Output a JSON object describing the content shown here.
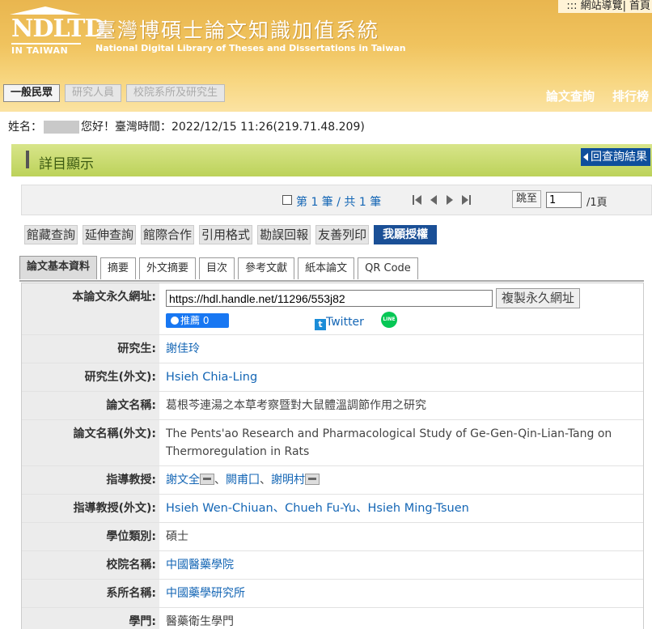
{
  "top_links": [
    "::: 網站導覽",
    "首頁"
  ],
  "brand": {
    "logo_main": "NDLTD",
    "logo_sub": "IN TAIWAN",
    "title_zh": "臺灣博碩士論文知識加值系統",
    "title_en": "National Digital Library of Theses and Dissertations in Taiwan"
  },
  "role_tabs": [
    "一般民眾",
    "研究人員",
    "校院系所及研究生"
  ],
  "nav_links": [
    "論文查詢",
    "排行榜"
  ],
  "greeting": {
    "name_label": "姓名：",
    "text": "您好！臺灣時間：2022/12/15 11:26(219.71.48.209)"
  },
  "panel": {
    "title": "詳目顯示",
    "back_label": "回查詢結果"
  },
  "pager": {
    "count": "第 1 筆 / 共 1 筆",
    "jump_label": "跳至",
    "jump_value": "1",
    "total": "/1頁"
  },
  "tools": [
    "館藏查詢",
    "延伸查詢",
    "館際合作",
    "引用格式",
    "勘誤回報",
    "友善列印",
    "我願授權"
  ],
  "tabs": [
    "論文基本資料",
    "摘要",
    "外文摘要",
    "目次",
    "參考文獻",
    "紙本論文",
    "QR Code"
  ],
  "record": {
    "url_label": "本論文永久網址:",
    "url_value": "https://hdl.handle.net/11296/553j82",
    "copy_label": "複製永久網址",
    "fb_label": "推薦 0",
    "twitter_label": "Twitter",
    "line_label": "LINE",
    "rows": [
      {
        "label": "研究生:",
        "value": "謝佳玲"
      },
      {
        "label": "研究生(外文):",
        "value": "Hsieh Chia-Ling"
      },
      {
        "label": "論文名稱:",
        "value": "葛根芩連湯之本草考察暨對大鼠體溫調節作用之研究"
      },
      {
        "label": "論文名稱(外文):",
        "value": "The Pents'ao Research and Pharmacological Study of Ge-Gen-Qin-Lian-Tang on Thermoregulation in Rats"
      },
      {
        "label": "指導教授:",
        "advisors": [
          "謝文全",
          "闕甫囗",
          "謝明村"
        ]
      },
      {
        "label": "指導教授(外文):",
        "value": "Hsieh Wen-Chiuan、Chueh Fu-Yu、Hsieh Ming-Tsuen"
      },
      {
        "label": "學位類別:",
        "value": "碩士"
      },
      {
        "label": "校院名稱:",
        "value": "中國醫藥學院"
      },
      {
        "label": "系所名稱:",
        "value": "中國藥學研究所"
      },
      {
        "label": "學門:",
        "value": "醫藥衛生學門"
      }
    ]
  }
}
